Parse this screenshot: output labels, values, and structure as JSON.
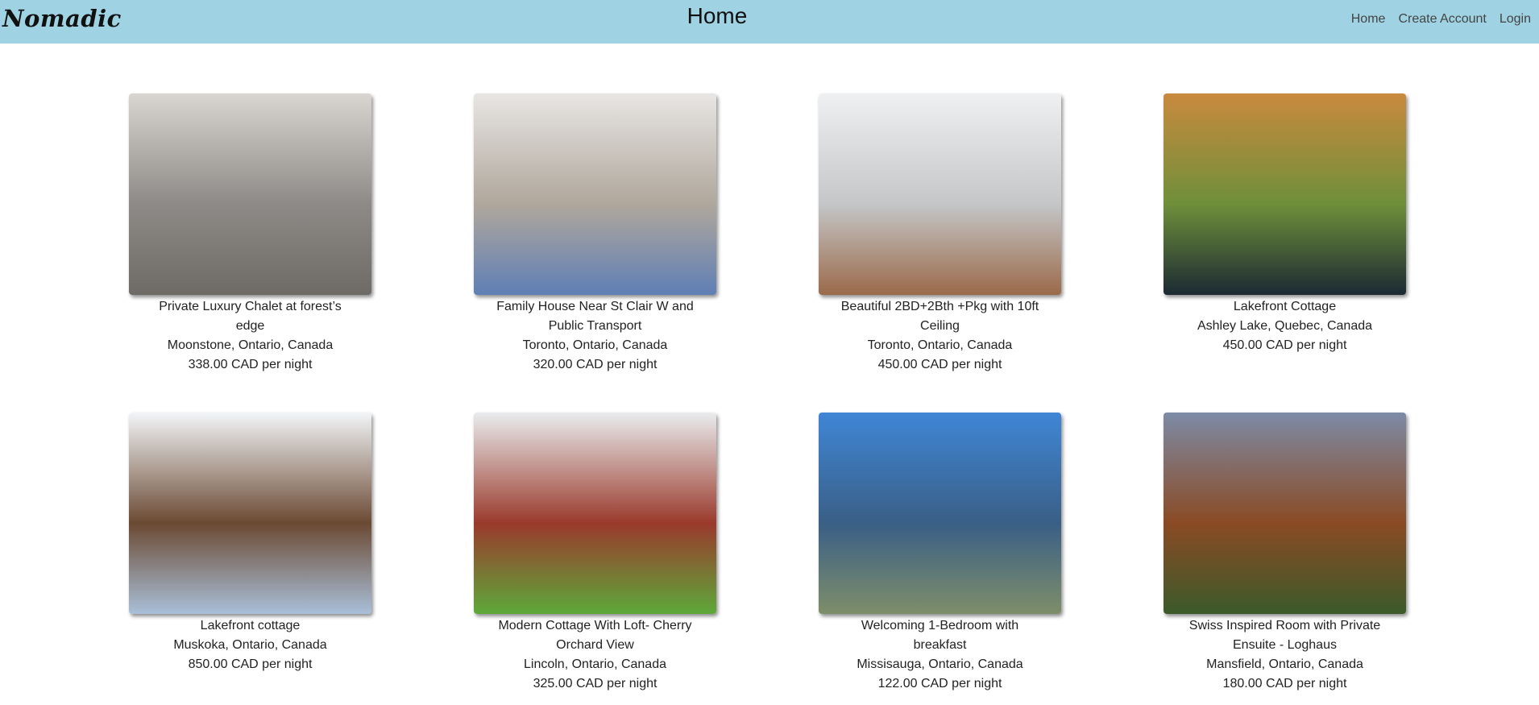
{
  "brand": "Nomadic",
  "page_title": "Home",
  "nav": {
    "home": "Home",
    "create_account": "Create Account",
    "login": "Login"
  },
  "listings": [
    {
      "title": "Private Luxury Chalet at forest’s edge",
      "location": "Moonstone, Ontario, Canada",
      "price": "338.00 CAD per night",
      "colors": [
        "#d9d6d2",
        "#8d8a87",
        "#6e6a66"
      ]
    },
    {
      "title": "Family House Near St Clair W and Public Transport",
      "location": "Toronto, Ontario, Canada",
      "price": "320.00 CAD per night",
      "colors": [
        "#e8e6e4",
        "#b0a79c",
        "#5f7fb5"
      ]
    },
    {
      "title": "Beautiful 2BD+2Bth +Pkg with 10ft Ceiling",
      "location": "Toronto, Ontario, Canada",
      "price": "450.00 CAD per night",
      "colors": [
        "#eef0f2",
        "#c4c6c8",
        "#9b6a4a"
      ]
    },
    {
      "title": "Lakefront Cottage",
      "location": "Ashley Lake, Quebec, Canada",
      "price": "450.00 CAD per night",
      "colors": [
        "#c98a3e",
        "#6f8f3a",
        "#1c2a33"
      ]
    },
    {
      "title": "Lakefront cottage",
      "location": "Muskoka, Ontario, Canada",
      "price": "850.00 CAD per night",
      "colors": [
        "#f2f5f8",
        "#6b4a33",
        "#a9bfd8"
      ]
    },
    {
      "title": "Modern Cottage With Loft- Cherry Orchard View",
      "location": "Lincoln, Ontario, Canada",
      "price": "325.00 CAD per night",
      "colors": [
        "#e9ecee",
        "#9a3a2c",
        "#5ea83a"
      ]
    },
    {
      "title": "Welcoming 1-Bedroom with breakfast",
      "location": "Missisauga, Ontario, Canada",
      "price": "122.00 CAD per night",
      "colors": [
        "#3f86d6",
        "#3a5f86",
        "#7e8e6a"
      ]
    },
    {
      "title": "Swiss Inspired Room with Private Ensuite - Loghaus",
      "location": "Mansfield, Ontario, Canada",
      "price": "180.00 CAD per night",
      "colors": [
        "#7d8ba6",
        "#8a4a24",
        "#3b5a2a"
      ]
    }
  ]
}
